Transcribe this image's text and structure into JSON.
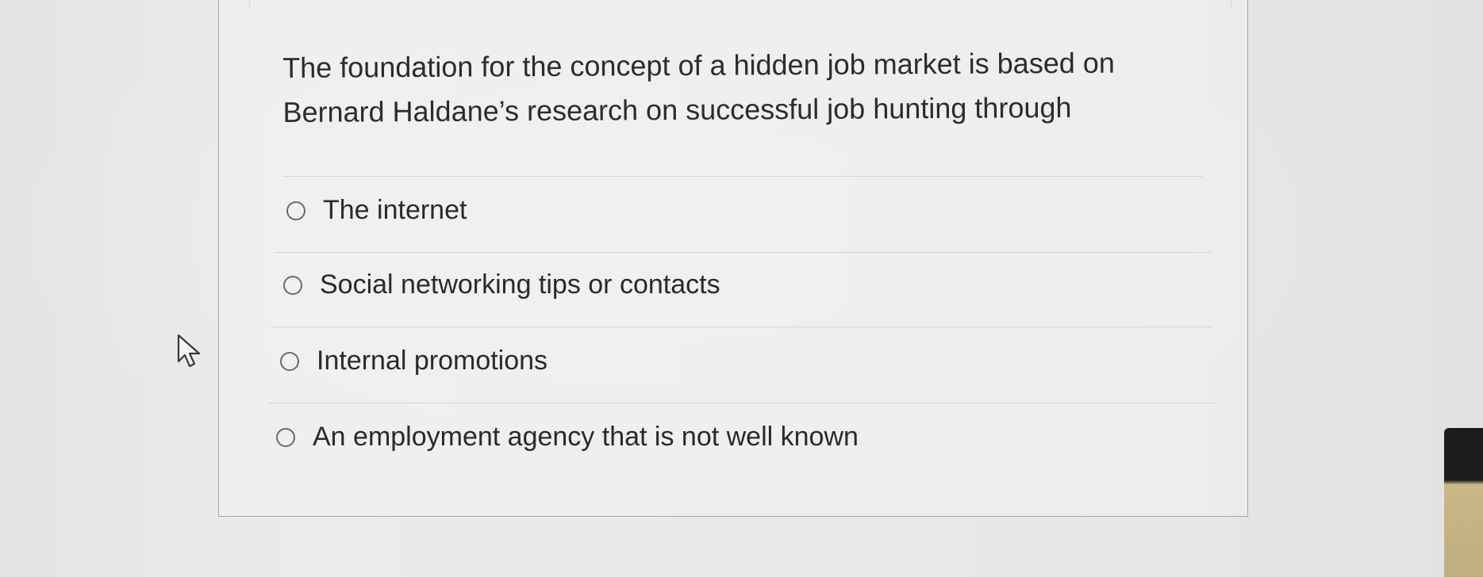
{
  "question": {
    "text": "The foundation for the concept of a hidden job market is based on Bernard Haldane’s research on successful job hunting through"
  },
  "options": [
    {
      "label": "The internet"
    },
    {
      "label": "Social networking tips or contacts"
    },
    {
      "label": "Internal promotions"
    },
    {
      "label": "An employment agency that is not well known"
    }
  ],
  "colors": {
    "background": "#e8e8e6",
    "card_border": "#a9a9a7",
    "text": "#2c2c2c",
    "radio_border": "#6a6a6a"
  },
  "icons": {
    "cursor": "arrow-cursor-icon",
    "radio": "radio-unselected-icon"
  }
}
